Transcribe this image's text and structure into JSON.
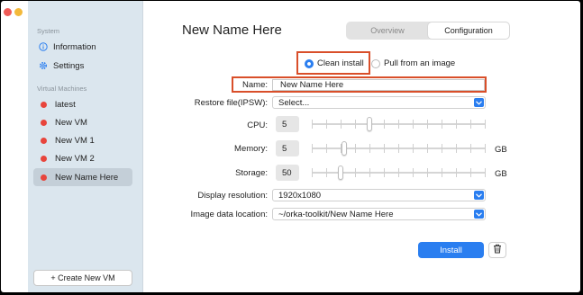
{
  "sidebar": {
    "system_title": "System",
    "information": {
      "label": "Information",
      "icon": "info-circle-icon"
    },
    "settings": {
      "label": "Settings",
      "icon": "gear-icon"
    },
    "vms_title": "Virtual Machines",
    "vms": [
      {
        "label": "latest",
        "status_color": "#e8453c",
        "selected": false
      },
      {
        "label": "New VM",
        "status_color": "#e8453c",
        "selected": false
      },
      {
        "label": "New VM 1",
        "status_color": "#e8453c",
        "selected": false
      },
      {
        "label": "New VM 2",
        "status_color": "#e8453c",
        "selected": false
      },
      {
        "label": "New Name Here",
        "status_color": "#e8453c",
        "selected": true
      }
    ],
    "create_button": "+ Create New VM"
  },
  "main": {
    "title": "New Name Here",
    "tabs": [
      {
        "label": "Overview",
        "active": false
      },
      {
        "label": "Configuration",
        "active": true
      }
    ],
    "install_source": {
      "options": [
        {
          "label": "Clean install",
          "selected": true
        },
        {
          "label": "Pull from an image",
          "selected": false
        }
      ]
    },
    "form": {
      "name_label": "Name:",
      "name_value": "New Name Here",
      "restore_label": "Restore file(IPSW):",
      "restore_value": "Select...",
      "cpu_label": "CPU:",
      "cpu_value": "5",
      "memory_label": "Memory:",
      "memory_value": "5",
      "memory_unit": "GB",
      "storage_label": "Storage:",
      "storage_value": "50",
      "storage_unit": "GB",
      "display_label": "Display resolution:",
      "display_value": "1920x1080",
      "image_location_label": "Image data location:",
      "image_location_value": "~/orka-toolkit/New Name Here"
    },
    "install_button": "Install",
    "delete_icon": "trash-icon"
  },
  "colors": {
    "accent": "#2a7ef0",
    "highlight_border": "#d94f2a",
    "status_stopped": "#e8453c",
    "sidebar_bg": "#dbe6ee"
  }
}
